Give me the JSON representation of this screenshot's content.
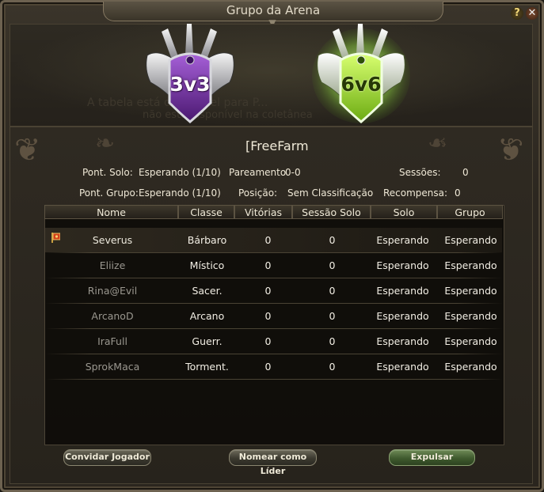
{
  "window": {
    "title": "Grupo da Arena",
    "help_label": "?",
    "close_label": "✕"
  },
  "banner": {
    "badges": [
      {
        "label": "3v3",
        "state": "normal",
        "color": "#8b3fb5"
      },
      {
        "label": "6v6",
        "state": "selected",
        "color": "#8ed12a"
      }
    ],
    "background_text_1": "A tabela está disponível para P...",
    "background_text_2": "não está disponível na coletânea"
  },
  "group": {
    "name": "[FreeFarm"
  },
  "info": {
    "solo_points_label": "Pont. Solo:",
    "solo_points_value": "Esperando (1/10)",
    "pairing_label": "Pareamento",
    "pairing_value": "0-0",
    "sessions_label": "Sessões:",
    "sessions_value": "0",
    "group_points_label": "Pont. Grupo:",
    "group_points_value": "Esperando (1/10)",
    "position_label": "Posição:",
    "position_value": "Sem Classificação",
    "reward_label": "Recompensa:",
    "reward_value": "0"
  },
  "table": {
    "columns": [
      "Nome",
      "Classe",
      "Vitórias",
      "Sessão Solo",
      "Solo",
      "Grupo"
    ],
    "rows": [
      {
        "name": "Severus",
        "class": "Bárbaro",
        "wins": "0",
        "solo_session": "0",
        "solo": "Esperando",
        "group": "Esperando",
        "leader": true
      },
      {
        "name": "Eliize",
        "class": "Místico",
        "wins": "0",
        "solo_session": "0",
        "solo": "Esperando",
        "group": "Esperando",
        "leader": false
      },
      {
        "name": "Rina@Evil",
        "class": "Sacer.",
        "wins": "0",
        "solo_session": "0",
        "solo": "Esperando",
        "group": "Esperando",
        "leader": false
      },
      {
        "name": "ArcanoD",
        "class": "Arcano",
        "wins": "0",
        "solo_session": "0",
        "solo": "Esperando",
        "group": "Esperando",
        "leader": false
      },
      {
        "name": "IraFull",
        "class": "Guerr.",
        "wins": "0",
        "solo_session": "0",
        "solo": "Esperando",
        "group": "Esperando",
        "leader": false
      },
      {
        "name": "SprokMaca",
        "class": "Torment.",
        "wins": "0",
        "solo_session": "0",
        "solo": "Esperando",
        "group": "Esperando",
        "leader": false
      }
    ]
  },
  "buttons": {
    "invite": "Convidar Jogador",
    "make_leader": "Nomear como Líder",
    "expel": "Expulsar"
  },
  "icons": {
    "leader": "leader-flag-icon",
    "help": "help-icon",
    "close": "close-icon"
  }
}
